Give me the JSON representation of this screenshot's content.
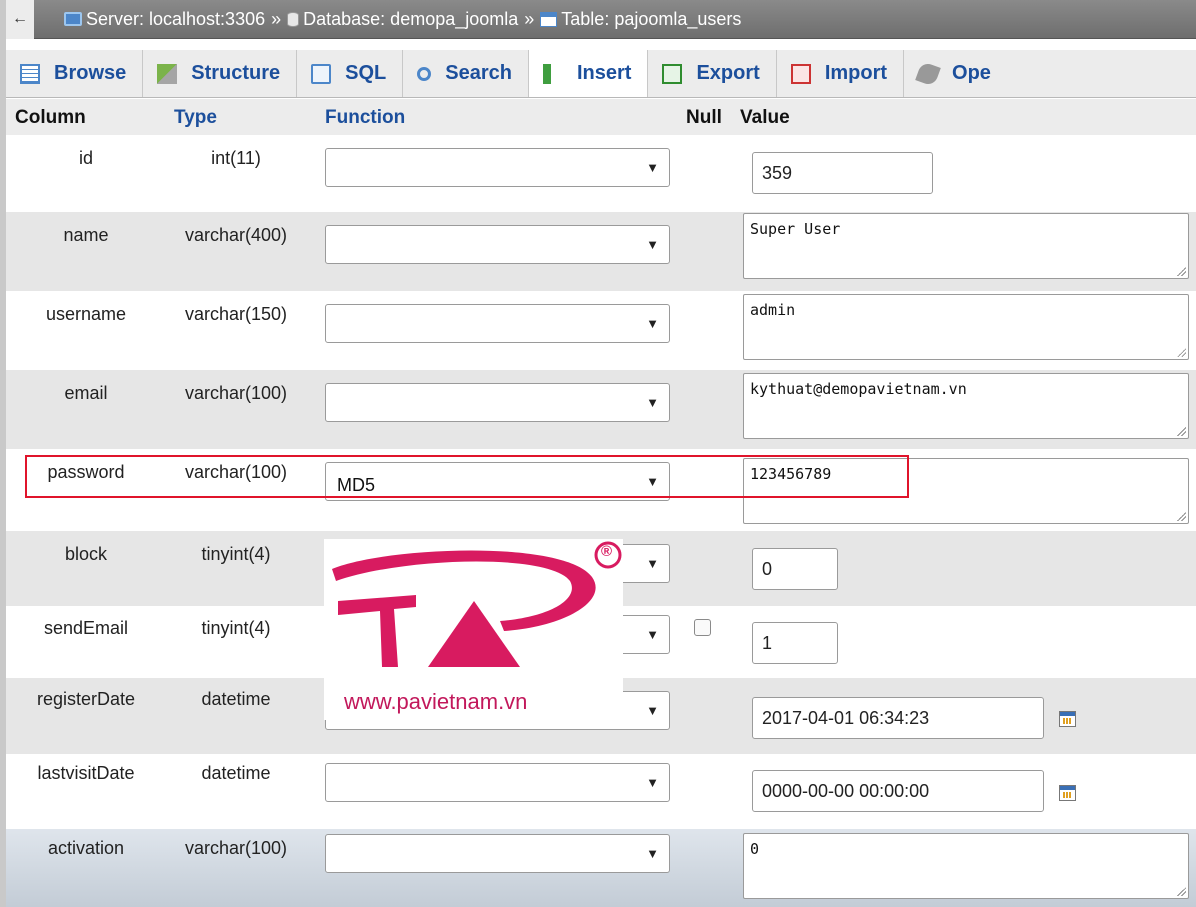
{
  "breadcrumb": {
    "back": "←",
    "server": "Server: localhost:3306",
    "database": "Database: demopa_joomla",
    "table": "Table: pajoomla_users",
    "separator": "»"
  },
  "tabs": [
    {
      "label": "Browse",
      "icon": "browse-icon"
    },
    {
      "label": "Structure",
      "icon": "structure-icon"
    },
    {
      "label": "SQL",
      "icon": "sql-icon"
    },
    {
      "label": "Search",
      "icon": "search-icon"
    },
    {
      "label": "Insert",
      "icon": "insert-icon",
      "active": true
    },
    {
      "label": "Export",
      "icon": "export-icon"
    },
    {
      "label": "Import",
      "icon": "import-icon"
    },
    {
      "label": "Ope",
      "icon": "wrench-icon"
    }
  ],
  "header": {
    "column": "Column",
    "type": "Type",
    "function": "Function",
    "null": "Null",
    "value": "Value"
  },
  "rows": [
    {
      "column": "id",
      "type": "int(11)",
      "function": "",
      "value": "359"
    },
    {
      "column": "name",
      "type": "varchar(400)",
      "function": "",
      "value": "Super User"
    },
    {
      "column": "username",
      "type": "varchar(150)",
      "function": "",
      "value": "admin"
    },
    {
      "column": "email",
      "type": "varchar(100)",
      "function": "",
      "value": "kythuat@demopavietnam.vn"
    },
    {
      "column": "password",
      "type": "varchar(100)",
      "function": "MD5",
      "value": "123456789"
    },
    {
      "column": "block",
      "type": "tinyint(4)",
      "function": "",
      "value": "0"
    },
    {
      "column": "sendEmail",
      "type": "tinyint(4)",
      "function": "",
      "value": "1"
    },
    {
      "column": "registerDate",
      "type": "datetime",
      "function": "",
      "value": "2017-04-01 06:34:23"
    },
    {
      "column": "lastvisitDate",
      "type": "datetime",
      "function": "",
      "value": "0000-00-00 00:00:00"
    },
    {
      "column": "activation",
      "type": "varchar(100)",
      "function": "",
      "value": "0"
    }
  ],
  "watermark": {
    "url": "www.pavietnam.vn",
    "registered": "®"
  },
  "colors": {
    "highlight": "#e0142b",
    "brand_pink": "#c2185b",
    "link_blue": "#1c4f9c"
  }
}
